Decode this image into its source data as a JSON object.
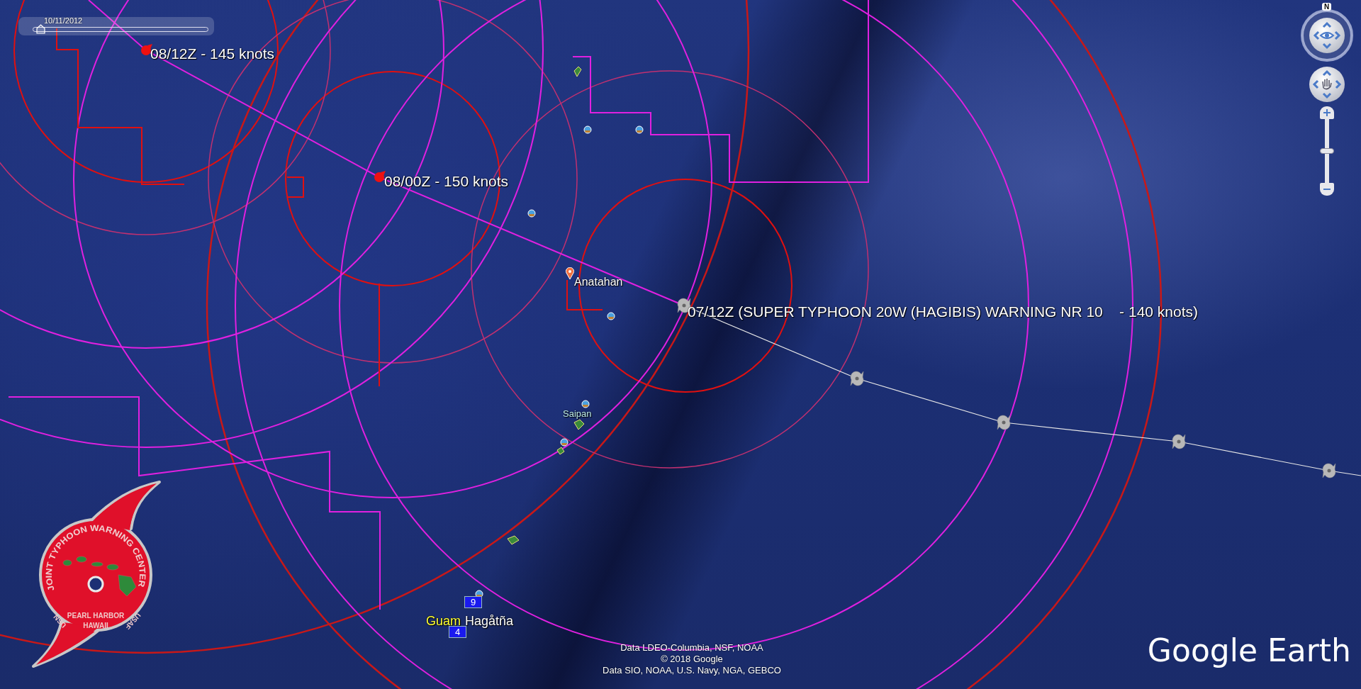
{
  "timeline": {
    "date": "10/11/2012",
    "level": 0.02
  },
  "track_points": [
    {
      "label": "08/12Z - 145 knots",
      "kind": "forecast"
    },
    {
      "label": "08/00Z - 150 knots",
      "kind": "forecast"
    },
    {
      "label": "07/12Z (SUPER TYPHOON 20W (HAGIBIS) WARNING NR 10    - 140 knots)",
      "kind": "current"
    }
  ],
  "places": [
    {
      "name": "Anatahan",
      "kind": "pin"
    },
    {
      "name": "Saipan",
      "kind": "island"
    },
    {
      "name": "Guam",
      "kind": "territory"
    },
    {
      "name": "Hagåtña",
      "kind": "capital"
    }
  ],
  "badges": [
    "9",
    "4"
  ],
  "navigation": {
    "north": "N",
    "zoom": {
      "level": 0.5
    }
  },
  "logo": {
    "title": "JOINT TYPHOON WARNING CENTER",
    "location": [
      "PEARL HARBOR",
      "HAWAII"
    ],
    "left_mark": "USN",
    "right_mark": "USAF"
  },
  "attribution": [
    "Data LDEO-Columbia, NSF, NOAA",
    "© 2018 Google",
    "Data SIO, NOAA, U.S. Navy, NGA, GEBCO"
  ],
  "brand": "Google Earth"
}
